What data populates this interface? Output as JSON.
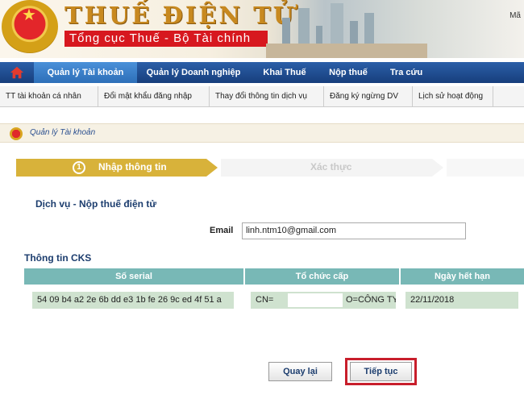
{
  "header": {
    "title": "THUẾ ĐIỆN TỬ",
    "subtitle": "Tổng cục Thuế - Bộ Tài chính",
    "right_text": "Mã"
  },
  "main_nav": [
    "Quản lý Tài khoản",
    "Quản lý Doanh nghiệp",
    "Khai Thuế",
    "Nộp thuế",
    "Tra cứu"
  ],
  "sub_nav": [
    "TT tài khoản cá nhân",
    "Đổi mật khẩu đăng nhập",
    "Thay đổi thông tin dịch vụ",
    "Đăng ký ngừng DV",
    "Lịch sử hoạt động"
  ],
  "breadcrumb": "Quản lý Tài khoản",
  "steps": {
    "step1_number": "1",
    "step1_label": "Nhập thông tin",
    "step2_label": "Xác thực"
  },
  "service_label": "Dịch vụ - Nộp thuế điện tử",
  "email": {
    "label": "Email",
    "value": "linh.ntm10@gmail.com"
  },
  "cks": {
    "title": "Thông tin CKS",
    "headers": [
      "Số serial",
      "Tổ chức cấp",
      "Ngày hết hạn"
    ],
    "row": {
      "serial": "54 09 b4 a2 2e 6b dd e3 1b fe 26 9c ed 4f 51 a",
      "issuer_prefix": "CN=",
      "issuer_suffix": "O=CÔNG TY",
      "expiry": "22/11/2018"
    }
  },
  "buttons": {
    "back": "Quay lại",
    "continue": "Tiếp tục"
  },
  "colors": {
    "nav_blue": "#1f4c92",
    "nav_active": "#3d82cd",
    "step_active": "#d8b23a",
    "table_header": "#78b8b6",
    "table_cell": "#cfe2cf",
    "highlight": "#c81e2b"
  }
}
